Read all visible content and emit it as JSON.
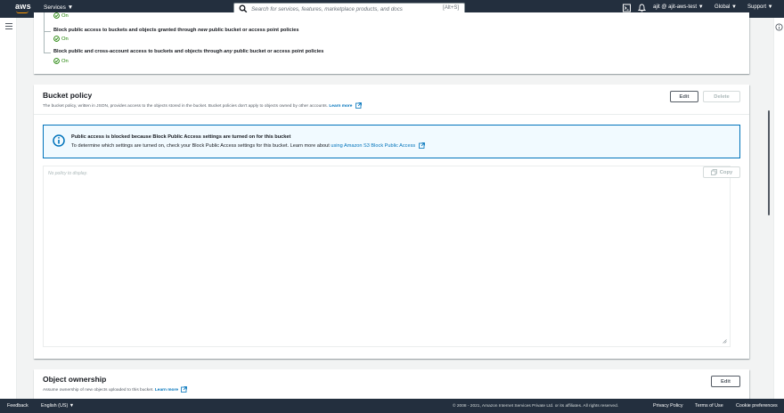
{
  "nav": {
    "logo": "aws",
    "services": "Services ▼",
    "search_placeholder": "Search for services, features, marketplace products, and docs",
    "search_shortcut": "[Alt+S]",
    "account": "ajit @ ajit-aws-test ▼",
    "region": "Global ▼",
    "support": "Support ▼"
  },
  "bpa": {
    "top_status": "On",
    "item2_pre": "Block public access to buckets and objects granted through ",
    "item2_em": "new",
    "item2_post": " public bucket or access point policies",
    "item2_status": "On",
    "item3_pre": "Block public and cross-account access to buckets and objects through ",
    "item3_em": "any",
    "item3_post": " public bucket or access point policies",
    "item3_status": "On"
  },
  "bucket_policy": {
    "title": "Bucket policy",
    "description": "The bucket policy, written in JSON, provides access to the objects stored in the bucket. Bucket policies don't apply to objects owned by other accounts.",
    "learn_more": "Learn more",
    "edit_label": "Edit",
    "delete_label": "Delete",
    "alert_title": "Public access is blocked because Block Public Access settings are turned on for this bucket",
    "alert_body": "To determine which settings are turned on, check your Block Public Access settings for this bucket. Learn more about",
    "alert_link": "using Amazon S3 Block Public Access",
    "editor_placeholder": "No policy to display.",
    "copy_label": "Copy"
  },
  "object_ownership": {
    "title": "Object ownership",
    "description": "Assume ownership of new objects uploaded to this bucket.",
    "learn_more": "Learn more",
    "edit_label": "Edit"
  },
  "footer": {
    "feedback": "Feedback",
    "language": "English (US) ▼",
    "copyright": "© 2008 - 2021, Amazon Internet Services Private Ltd. or its affiliates. All rights reserved.",
    "privacy": "Privacy Policy",
    "terms": "Terms of Use",
    "cookies": "Cookie preferences"
  },
  "colors": {
    "nav_bg": "#232f3e",
    "link": "#0073bb",
    "success": "#1d8102",
    "alert_bg": "#f1faff"
  }
}
